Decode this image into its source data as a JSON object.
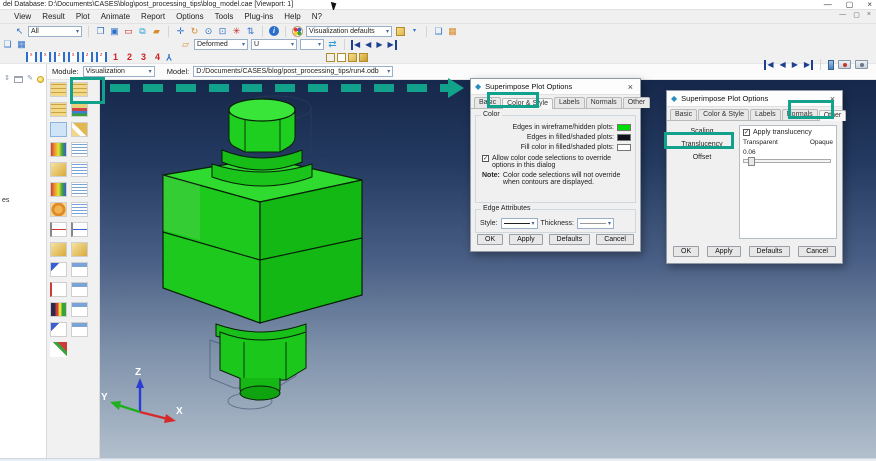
{
  "window": {
    "title": "del Database: D:\\Documents\\CASES\\blog\\post_processing_tips\\blog_model.cae  [Viewport: 1]",
    "minimize": "—",
    "maximize": "▢",
    "close": "×"
  },
  "menubar": {
    "items": [
      "View",
      "Result",
      "Plot",
      "Animate",
      "Report",
      "Options",
      "Tools",
      "Plug-ins",
      "Help"
    ],
    "context_help": "N?"
  },
  "toolbar": {
    "all_value": "All",
    "viz_defaults_value": "Visualization defaults",
    "deformed_value": "Deformed",
    "u_value": "U",
    "empty_value": ""
  },
  "context_bar": {
    "module_label": "Module:",
    "module_value": "Visualization",
    "model_label": "Model:",
    "model_value": "D:/Documents/CASES/blog/post_processing_tips/run4.odb"
  },
  "field_row": {
    "numbers": [
      "1",
      "2",
      "3",
      "4"
    ]
  },
  "tree": {
    "fragment": "es"
  },
  "triad": {
    "x": "X",
    "y": "Y",
    "z": "Z"
  },
  "dialog1": {
    "title": "Superimpose Plot Options",
    "close": "×",
    "tabs": [
      "Basic",
      "Color & Style",
      "Labels",
      "Normals",
      "Other"
    ],
    "color_group": {
      "label": "Color",
      "edges_wireframe": "Edges in wireframe/hidden plots:",
      "edges_filled": "Edges in filled/shaded plots:",
      "fill_color": "Fill color in filled/shaded plots:",
      "override_checkbox": "Allow color code selections to override options in this dialog",
      "note_label": "Note:",
      "note_text": "Color code selections will not override when contours are displayed."
    },
    "edge_group": {
      "label": "Edge Attributes",
      "style_label": "Style:",
      "thickness_label": "Thickness:"
    },
    "buttons": [
      "OK",
      "Apply",
      "Defaults",
      "Cancel"
    ]
  },
  "dialog2": {
    "title": "Superimpose Plot Options",
    "close": "×",
    "tabs": [
      "Basic",
      "Color & Style",
      "Labels",
      "Normals",
      "Other"
    ],
    "side_items": [
      "Scaling",
      "Translucency",
      "Offset"
    ],
    "apply_checkbox": "Apply translucency",
    "transparent_label": "Transparent",
    "opaque_label": "Opaque",
    "value": "0.06",
    "buttons": [
      "OK",
      "Apply",
      "Defaults",
      "Cancel"
    ]
  },
  "icons": {
    "check": "✓",
    "dropdown": "▾",
    "logo": "◆",
    "select": "↖",
    "duplicate": "❐",
    "link": "▣",
    "rect": "▭",
    "views": "⧉",
    "box": "▰",
    "pan": "✛",
    "rotate": "↻",
    "zoom": "⊙",
    "zoom_box": "⊡",
    "fit": "✳",
    "cycle": "⇅",
    "info": "i",
    "swap": "⇄",
    "prev": "◀",
    "next": "▶",
    "plot_state": "▱",
    "spin": "⇕",
    "pencil": "✎",
    "person": "Y",
    "stack1": "❏",
    "stack2": "▦"
  },
  "colors": {
    "accent": "#12a28b",
    "edge_wireframe_swatch": "#00dd00",
    "model_green": "#1ec91e"
  }
}
